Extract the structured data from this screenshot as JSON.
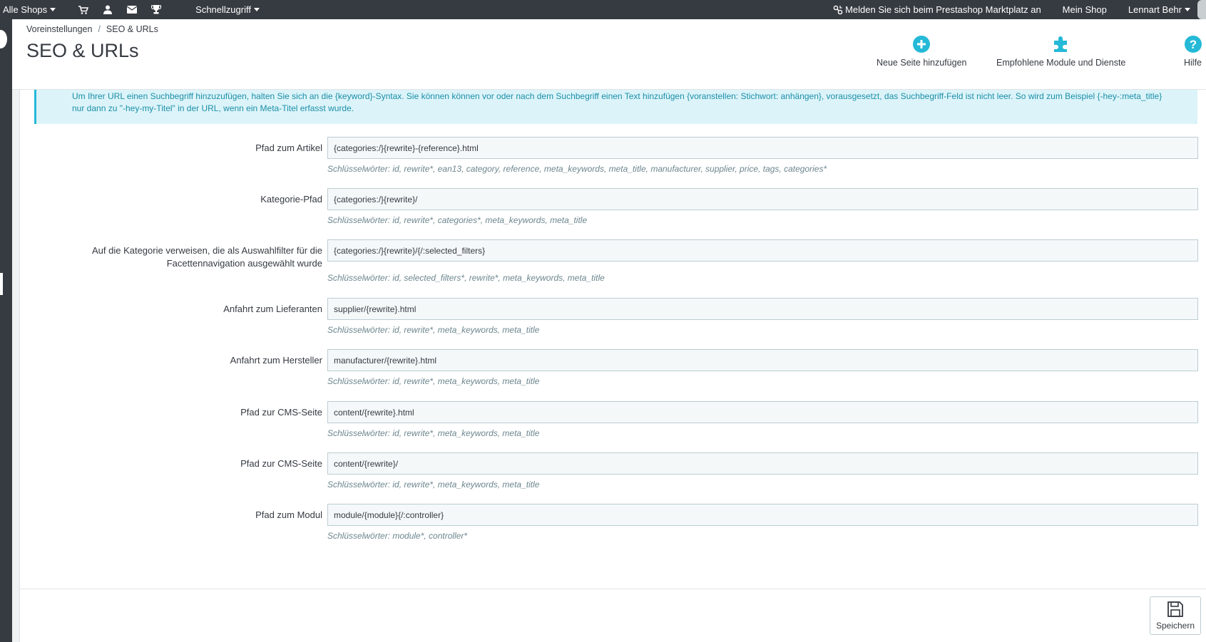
{
  "topbar": {
    "shop_selector": "Alle Shops",
    "icons": [
      "cart-icon",
      "user-icon",
      "envelope-icon",
      "trophy-icon"
    ],
    "quick_access": "Schnellzugriff",
    "marketplace_link": "Melden Sie sich beim Prestashop Marktplatz an",
    "my_shop": "Mein Shop",
    "user_name": "Lennart Behr"
  },
  "header": {
    "breadcrumb": [
      "Voreinstellungen",
      "SEO & URLs"
    ],
    "title": "SEO & URLs",
    "actions": [
      {
        "label": "Neue Seite hinzufügen",
        "icon": "plus-circle-icon"
      },
      {
        "label": "Empfohlene Module und Dienste",
        "icon": "puzzle-icon"
      },
      {
        "label": "Hilfe",
        "icon": "help-icon"
      }
    ]
  },
  "alert": {
    "text": "Um Ihrer URL einen Suchbegriff hinzuzufügen, halten Sie sich an die {keyword}-Syntax. Sie können können vor oder nach dem Suchbegriff einen Text hinzufügen {voranstellen: Stichwort: anhängen}, vorausgesetzt, das Suchbegriff-Feld ist nicht leer. So wird zum Beispiel {-hey-:meta_title} nur dann zu \"-hey-my-Titel\" in der URL, wenn ein Meta-Titel erfasst wurde."
  },
  "form": {
    "rows": [
      {
        "label": "Pfad zum Artikel",
        "value": "{categories:/}{rewrite}-{reference}.html",
        "help": "Schlüsselwörter: id, rewrite*, ean13, category, reference, meta_keywords, meta_title, manufacturer, supplier, price, tags, categories*"
      },
      {
        "label": "Kategorie-Pfad",
        "value": "{categories:/}{rewrite}/",
        "help": "Schlüsselwörter: id, rewrite*, categories*, meta_keywords, meta_title"
      },
      {
        "label_line1": "Auf die Kategorie verweisen, die als Auswahlfilter für die",
        "label_line2": "Facettennavigation ausgewählt wurde",
        "value": "{categories:/}{rewrite}/{/:selected_filters}",
        "help": "Schlüsselwörter: id, selected_filters*, rewrite*, meta_keywords, meta_title"
      },
      {
        "label": "Anfahrt zum Lieferanten",
        "value": "supplier/{rewrite}.html",
        "help": "Schlüsselwörter: id, rewrite*, meta_keywords, meta_title"
      },
      {
        "label": "Anfahrt zum Hersteller",
        "value": "manufacturer/{rewrite}.html",
        "help": "Schlüsselwörter: id, rewrite*, meta_keywords, meta_title"
      },
      {
        "label": "Pfad zur CMS-Seite",
        "value": "content/{rewrite}.html",
        "help": "Schlüsselwörter: id, rewrite*, meta_keywords, meta_title"
      },
      {
        "label": "Pfad zur CMS-Seite",
        "value": "content/{rewrite}/",
        "help": "Schlüsselwörter: id, rewrite*, meta_keywords, meta_title"
      },
      {
        "label": "Pfad zum Modul",
        "value": "module/{module}{/:controller}",
        "help": "Schlüsselwörter: module*, controller*"
      }
    ]
  },
  "footer": {
    "save_label": "Speichern"
  },
  "colors": {
    "topbar": "#363a41",
    "accent": "#25b9d7",
    "alert_bg": "#dcf4f9"
  }
}
